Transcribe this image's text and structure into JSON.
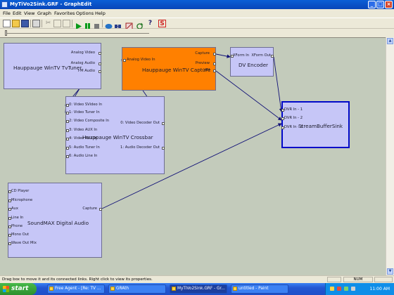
{
  "window": {
    "title": "MyTiVo2Sink.GRF - GraphEdit"
  },
  "menu": [
    "File",
    "Edit",
    "View",
    "Graph",
    "Favorites",
    "Options",
    "Help"
  ],
  "toolbar": {
    "icons": [
      "new-icon",
      "open-icon",
      "save-icon",
      "print-icon",
      "cut-icon",
      "copy-icon",
      "paste-icon",
      "play-icon",
      "pause-icon",
      "stop-icon",
      "seek-icon",
      "frame-step-icon",
      "filter-graph-icon",
      "refresh-icon",
      "help-icon",
      "s-icon"
    ],
    "s_label": "S",
    "help_label": "?"
  },
  "filters": {
    "tvtuner": {
      "name": "Hauppauge WinTV TvTuner",
      "pins_out": [
        "Analog Video",
        "Analog Audio",
        "I-M Audio"
      ]
    },
    "capture": {
      "name": "Hauppauge WinTV Capture",
      "pins_in": [
        "Analog Video In"
      ],
      "pins_out": [
        "Capture",
        "Preview",
        "VBI"
      ],
      "color": "#ff8000"
    },
    "dvencoder": {
      "name": "DV Encoder",
      "pins_in": [
        "XForm In"
      ],
      "pins_out": [
        "XForm Out"
      ]
    },
    "crossbar": {
      "name": "Hauppauge WinTV Crossbar",
      "pins_in": [
        "0: Video SVideo In",
        "1: Video Tuner In",
        "2: Video Composite In",
        "3: Video AUX In",
        "4: Video AUX In",
        "5: Audio Tuner In",
        "6: Audio Line In"
      ],
      "pins_out": [
        "0: Video Decoder Out",
        "1: Audio Decoder Out"
      ]
    },
    "sink": {
      "name": "StreamBufferSink",
      "pins_in": [
        "DVR In - 1",
        "DVR In - 2",
        "DVR In - 3"
      ]
    },
    "soundmax": {
      "name": "SoundMAX Digital Audio",
      "pins_in": [
        "CD Player",
        "Microphone",
        "Aux",
        "Line In",
        "Phone",
        "Mono Out",
        "Wave Out Mix"
      ],
      "pins_out": [
        "Capture"
      ]
    }
  },
  "status": {
    "text": "Drag box to move it and its connected links. Right click to view its properties.",
    "num": "NUM"
  },
  "taskbar": {
    "start": "start",
    "tasks": [
      "Free Agent - [Re: TV ...",
      "GRAth",
      "MyTiVo2Sink.GRF - Gr...",
      "untitled - Paint"
    ],
    "clock": "11:00 AM"
  }
}
